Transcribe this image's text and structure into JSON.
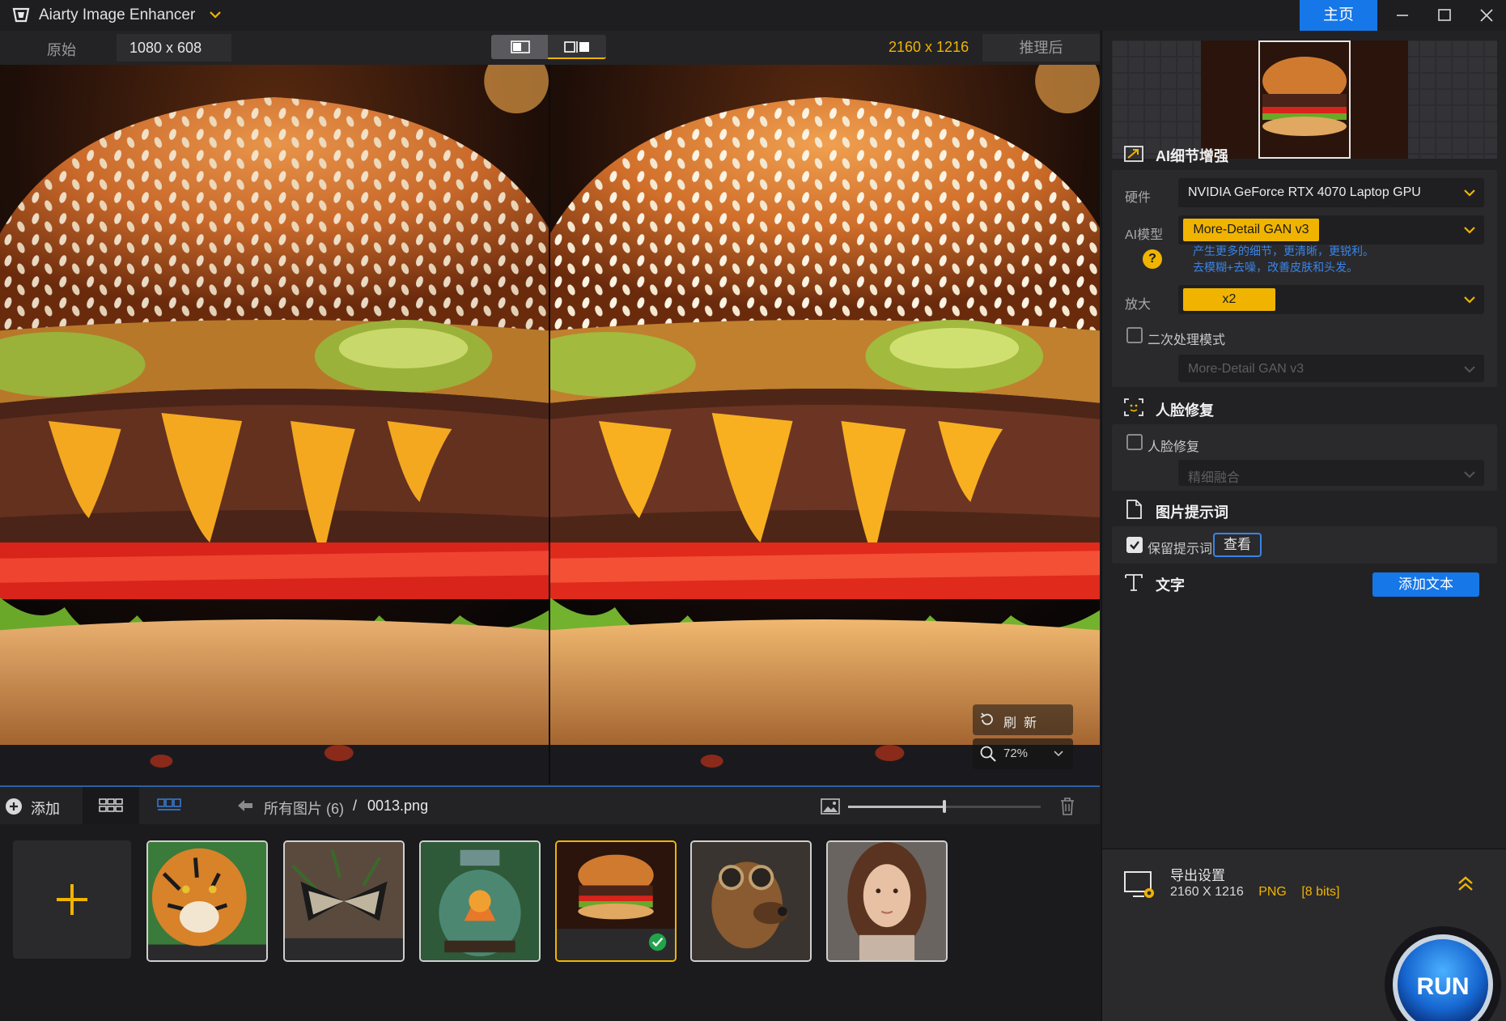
{
  "titlebar": {
    "app_title": "Aiarty Image Enhancer",
    "home_label": "主页"
  },
  "compare": {
    "original_label": "原始",
    "original_resolution": "1080 x 608",
    "output_resolution": "2160 x 1216",
    "output_label": "推理后"
  },
  "overlay": {
    "refresh_label": "刷新",
    "zoom_value": "72%"
  },
  "toolbar": {
    "add_label": "添加",
    "breadcrumb_all": "所有图片 (6)",
    "breadcrumb_sep": "/",
    "breadcrumb_file": "0013.png",
    "thumb_size_level": 0.5
  },
  "thumbnails": [
    {
      "name": "tiger",
      "selected": false
    },
    {
      "name": "butterfly",
      "selected": false
    },
    {
      "name": "terrarium",
      "selected": false
    },
    {
      "name": "burger",
      "selected": true
    },
    {
      "name": "dog-goggles",
      "selected": false
    },
    {
      "name": "portrait",
      "selected": false
    }
  ],
  "panel": {
    "ai_section_title": "AI细节增强",
    "hardware_label": "硬件",
    "hardware_value": "NVIDIA GeForce RTX 4070 Laptop GPU",
    "model_label": "AI模型",
    "model_value": "More-Detail GAN  v3",
    "model_hint_line1": "产生更多的细节，更清晰，更锐利。",
    "model_hint_line2": "去模糊+去噪，改善皮肤和头发。",
    "help_symbol": "?",
    "scale_label": "放大",
    "scale_value": "x2",
    "secondary_mode_label": "二次处理模式",
    "secondary_mode_checked": false,
    "secondary_model_value": "More-Detail GAN  v3",
    "face_section_title": "人脸修复",
    "face_repair_label": "人脸修复",
    "face_repair_checked": false,
    "face_mode_value": "精细融合",
    "prompt_section_title": "图片提示词",
    "keep_prompt_label": "保留提示词",
    "keep_prompt_checked": true,
    "view_button_label": "查看",
    "text_section_title": "文字",
    "add_text_label": "添加文本"
  },
  "export": {
    "title": "导出设置",
    "resolution": "2160 X 1216",
    "format": "PNG",
    "bits": "[8 bits]"
  },
  "run_label": "RUN",
  "colors": {
    "accent": "#f0b400",
    "primary_blue": "#1677e8",
    "hint_blue": "#3a84e6"
  }
}
